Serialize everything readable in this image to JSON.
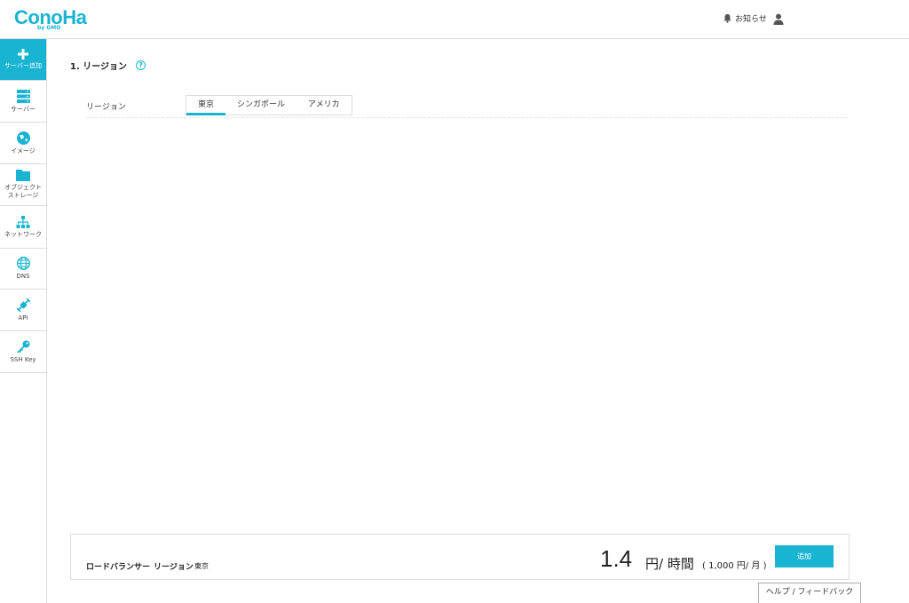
{
  "header": {
    "logo": "ConoHa",
    "logo_sub": "by GMO",
    "notice_label": "お知らせ"
  },
  "sidebar": {
    "items": [
      {
        "label": "サーバー追加",
        "icon": "plus-icon"
      },
      {
        "label": "サーバー",
        "icon": "server-icon"
      },
      {
        "label": "イメージ",
        "icon": "image-icon"
      },
      {
        "label": "オブジェクト\nストレージ",
        "icon": "folder-icon"
      },
      {
        "label": "ネットワーク",
        "icon": "network-icon"
      },
      {
        "label": "DNS",
        "icon": "globe-icon"
      },
      {
        "label": "API",
        "icon": "api-icon"
      },
      {
        "label": "SSH Key",
        "icon": "key-icon"
      }
    ]
  },
  "main": {
    "section_title": "1. リージョン",
    "help": "?",
    "region_label": "リージョン",
    "tabs": [
      {
        "label": "東京",
        "active": true
      },
      {
        "label": "シンガポール",
        "active": false
      },
      {
        "label": "アメリカ",
        "active": false
      }
    ]
  },
  "summary": {
    "service": "ロードバランサー",
    "region_key": "リージョン",
    "region_value": "東京",
    "price": "1.4",
    "price_unit": "円/ 時間",
    "monthly": "( 1,000 円/ 月 )",
    "add_button": "追加"
  },
  "feedback_label": "ヘルプ / フィードバック",
  "colors": {
    "accent": "#19b4d2"
  }
}
